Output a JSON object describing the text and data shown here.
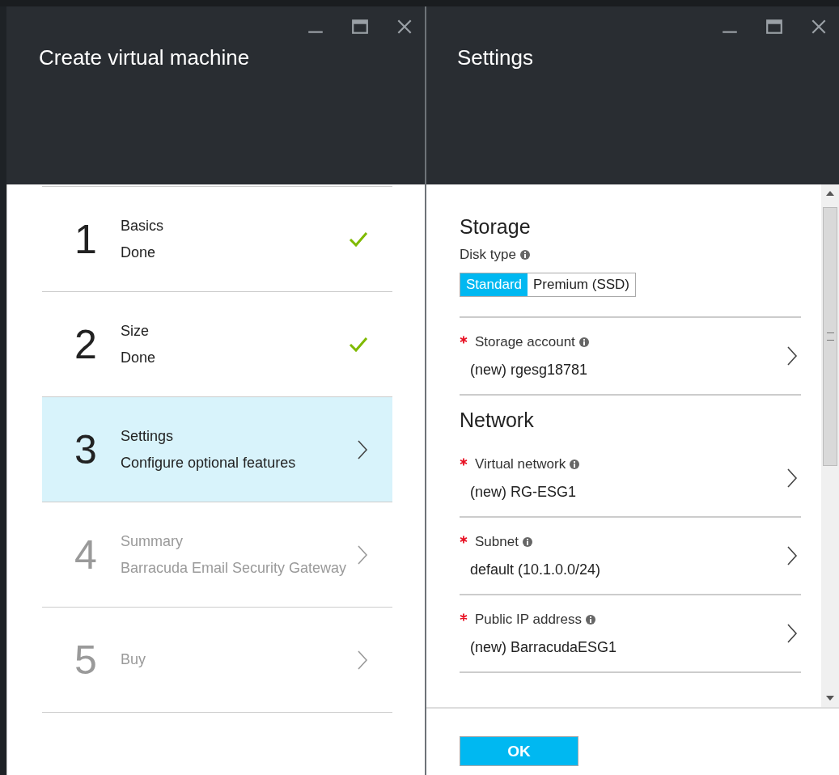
{
  "wizard_blade": {
    "title": "Create virtual machine",
    "steps": [
      {
        "number": "1",
        "title": "Basics",
        "subtitle": "Done",
        "kind": "done",
        "selected": false
      },
      {
        "number": "2",
        "title": "Size",
        "subtitle": "Done",
        "kind": "done",
        "selected": false
      },
      {
        "number": "3",
        "title": "Settings",
        "subtitle": "Configure optional features",
        "kind": "current",
        "selected": true
      },
      {
        "number": "4",
        "title": "Summary",
        "subtitle": "Barracuda Email Security Gateway",
        "kind": "pending",
        "selected": false
      },
      {
        "number": "5",
        "title": "Buy",
        "kind": "pending",
        "selected": false
      }
    ]
  },
  "settings_blade": {
    "title": "Settings",
    "sections": [
      {
        "heading": "Storage",
        "disk_type": {
          "label": "Disk type",
          "options": [
            {
              "label": "Standard",
              "selected": true
            },
            {
              "label": "Premium (SSD)",
              "selected": false
            }
          ]
        },
        "fields": [
          {
            "label": "Storage account",
            "required": true,
            "value": "(new) rgesg18781"
          }
        ]
      },
      {
        "heading": "Network",
        "fields": [
          {
            "label": "Virtual network",
            "required": true,
            "value": "(new) RG-ESG1"
          },
          {
            "label": "Subnet",
            "required": true,
            "value": "default (10.1.0.0/24)"
          },
          {
            "label": "Public IP address",
            "required": true,
            "value": "(new) BarracudaESG1"
          }
        ]
      }
    ],
    "ok_button": "OK"
  }
}
